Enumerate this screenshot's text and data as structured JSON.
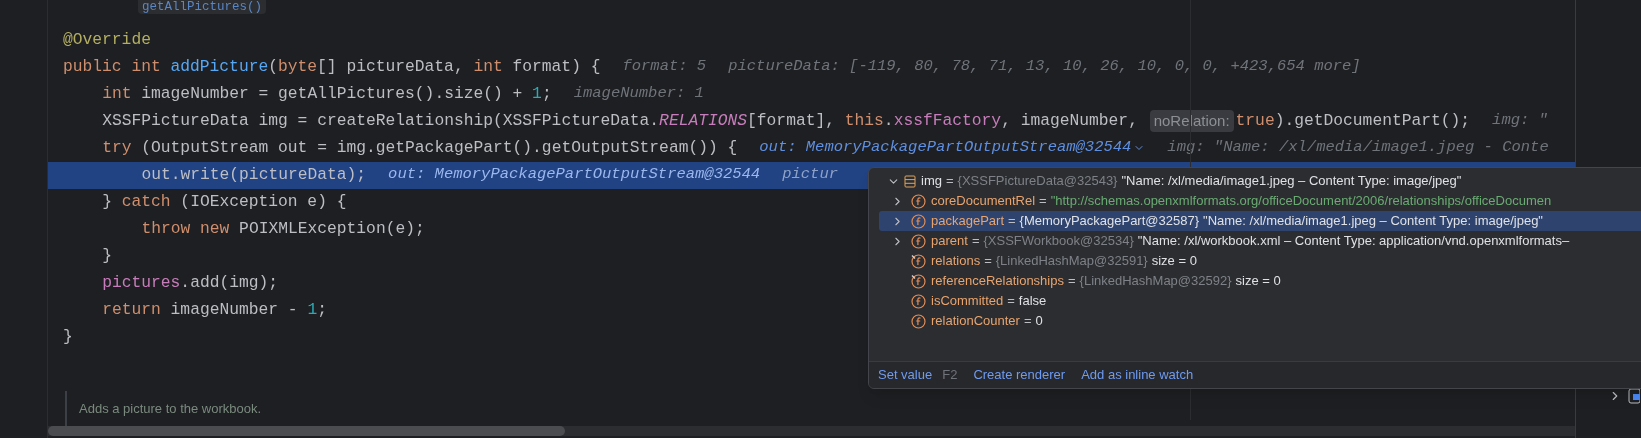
{
  "editor": {
    "top_hint": "getAllPictures()",
    "lines": [
      {
        "selected": false,
        "tokens": [
          {
            "kind": "ann",
            "text": "@Override"
          }
        ]
      },
      {
        "selected": false,
        "tokens": [
          {
            "kind": "kw",
            "text": "public "
          },
          {
            "kind": "kw",
            "text": "int "
          },
          {
            "kind": "decl",
            "text": "addPicture"
          },
          {
            "kind": "plain",
            "text": "("
          },
          {
            "kind": "kw",
            "text": "byte"
          },
          {
            "kind": "plain",
            "text": "[] pictureData, "
          },
          {
            "kind": "kw",
            "text": "int "
          },
          {
            "kind": "plain",
            "text": "format) {"
          }
        ],
        "hints": [
          {
            "kind": "value",
            "text": "format: 5",
            "dropdown": false
          },
          {
            "kind": "value",
            "text": "pictureData: [-119, 80, 78, 71, 13, 10, 26, 10, 0, 0, +423,654 more]",
            "dropdown": false
          }
        ],
        "children": [
          {
            "selected": false,
            "tokens": [
              {
                "kind": "kw",
                "text": "int "
              },
              {
                "kind": "plain",
                "text": "imageNumber = getAllPictures().size() + "
              },
              {
                "kind": "num",
                "text": "1"
              },
              {
                "kind": "plain",
                "text": ";"
              }
            ],
            "hints": [
              {
                "kind": "value",
                "text": "imageNumber: 1",
                "dropdown": false
              }
            ]
          },
          {
            "selected": false,
            "tokens": [
              {
                "kind": "plain",
                "text": "XSSFPictureData img = createRelationship(XSSFPictureData."
              },
              {
                "kind": "static",
                "text": "RELATIONS"
              },
              {
                "kind": "plain",
                "text": "[format], "
              },
              {
                "kind": "kw",
                "text": "this"
              },
              {
                "kind": "plain",
                "text": "."
              },
              {
                "kind": "field",
                "text": "xssfFactory"
              },
              {
                "kind": "plain",
                "text": ", imageNumber, "
              },
              {
                "kind": "param",
                "text": "noRelation:"
              },
              {
                "kind": "kw",
                "text": "true"
              },
              {
                "kind": "plain",
                "text": ").getDocumentPart();"
              }
            ],
            "hints": [
              {
                "kind": "value",
                "text": "img: \"",
                "dropdown": false
              }
            ]
          },
          {
            "selected": false,
            "tokens": [
              {
                "kind": "kw",
                "text": "try "
              },
              {
                "kind": "plain",
                "text": "(OutputStream out = img.getPackagePart().getOutputStream()) {"
              }
            ],
            "hints": [
              {
                "kind": "watch",
                "text": "out: MemoryPackagePartOutputStream@32544",
                "dropdown": true
              },
              {
                "kind": "value",
                "text": "img: \"Name: /xl/media/image1.jpeg - Conte",
                "dropdown": false
              }
            ],
            "children": [
              {
                "selected": true,
                "tokens": [
                  {
                    "kind": "plain",
                    "text": "out.write(pictureData);"
                  }
                ],
                "hints": [
                  {
                    "kind": "watch",
                    "text": "out: MemoryPackagePartOutputStream@32544",
                    "dropdown": false
                  },
                  {
                    "kind": "value",
                    "text": "pictur",
                    "dropdown": false
                  }
                ]
              }
            ]
          },
          {
            "selected": false,
            "tokens": [
              {
                "kind": "plain",
                "text": "} "
              },
              {
                "kind": "kw",
                "text": "catch "
              },
              {
                "kind": "plain",
                "text": "(IOException e) {"
              }
            ],
            "children": [
              {
                "selected": false,
                "tokens": [
                  {
                    "kind": "kw",
                    "text": "throw "
                  },
                  {
                    "kind": "kw",
                    "text": "new "
                  },
                  {
                    "kind": "plain",
                    "text": "POIXMLException(e);"
                  }
                ]
              }
            ]
          },
          {
            "selected": false,
            "tokens": [
              {
                "kind": "plain",
                "text": "}"
              }
            ]
          },
          {
            "selected": false,
            "tokens": [
              {
                "kind": "field",
                "text": "pictures"
              },
              {
                "kind": "plain",
                "text": ".add(img);"
              }
            ]
          },
          {
            "selected": false,
            "tokens": [
              {
                "kind": "kw",
                "text": "return "
              },
              {
                "kind": "plain",
                "text": "imageNumber - "
              },
              {
                "kind": "num",
                "text": "1"
              },
              {
                "kind": "plain",
                "text": ";"
              }
            ]
          }
        ]
      },
      {
        "selected": false,
        "tokens": [
          {
            "kind": "plain",
            "text": "}"
          }
        ]
      }
    ],
    "doc_comment": "Adds a picture to the workbook."
  },
  "debug_popup": {
    "root": {
      "name": "img",
      "sign": "=",
      "type": "{XSSFPictureData@32543}",
      "value": "\"Name: /xl/media/image1.jpeg – Content Type: image/jpeg\"",
      "expanded": true
    },
    "children": [
      {
        "kind": "string",
        "name": "coreDocumentRel",
        "sign": "=",
        "value": "\"http://schemas.openxmlformats.org/officeDocument/2006/relationships/officeDocumen",
        "expanded": false,
        "selected": false
      },
      {
        "kind": "object",
        "name": "packagePart",
        "sign": "=",
        "type": "{MemoryPackagePart@32587}",
        "value": "\"Name: /xl/media/image1.jpeg – Content Type: image/jpeg\"",
        "expanded": false,
        "selected": true
      },
      {
        "kind": "object",
        "name": "parent",
        "sign": "=",
        "type": "{XSSFWorkbook@32534}",
        "value": "\"Name: /xl/workbook.xml – Content Type: application/vnd.openxmlformats–",
        "expanded": false,
        "selected": false
      },
      {
        "kind": "map",
        "name": "relations",
        "sign": "=",
        "type": "{LinkedHashMap@32591}",
        "value": "size = 0",
        "selected": false
      },
      {
        "kind": "map",
        "name": "referenceRelationships",
        "sign": "=",
        "type": "{LinkedHashMap@32592}",
        "value": "size = 0",
        "selected": false
      },
      {
        "kind": "primitive",
        "name": "isCommitted",
        "sign": "=",
        "value": "false",
        "selected": false
      },
      {
        "kind": "primitive",
        "name": "relationCounter",
        "sign": "=",
        "value": "0",
        "selected": false
      }
    ],
    "actions": [
      {
        "label": "Set value",
        "shortcut": "F2"
      },
      {
        "label": "Create renderer"
      },
      {
        "label": "Add as inline watch"
      }
    ]
  }
}
